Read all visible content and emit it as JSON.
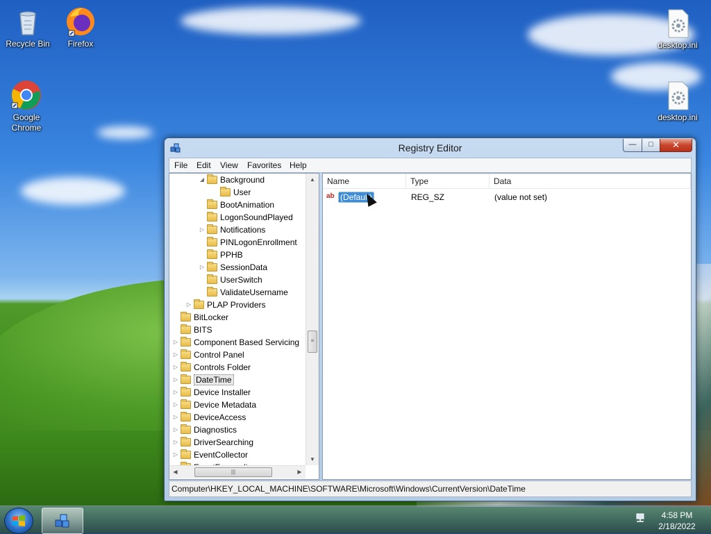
{
  "desktop": {
    "icons": [
      {
        "label": "Recycle Bin",
        "icon": "recycle-bin-icon"
      },
      {
        "label": "Firefox",
        "icon": "firefox-icon"
      },
      {
        "label": "Google Chrome",
        "icon": "chrome-icon"
      },
      {
        "label": "desktop.ini",
        "icon": "settings-file-icon"
      },
      {
        "label": "desktop.ini",
        "icon": "settings-file-icon"
      }
    ]
  },
  "window": {
    "title": "Registry Editor",
    "controls": {
      "minimize": "—",
      "maximize": "□",
      "close": "✕"
    },
    "menu": [
      "File",
      "Edit",
      "View",
      "Favorites",
      "Help"
    ]
  },
  "tree": {
    "items": [
      {
        "label": "Background",
        "expander": "◢",
        "level": 3
      },
      {
        "label": "User",
        "expander": "",
        "level": 4
      },
      {
        "label": "BootAnimation",
        "expander": "",
        "level": 3
      },
      {
        "label": "LogonSoundPlayed",
        "expander": "",
        "level": 3
      },
      {
        "label": "Notifications",
        "expander": "▷",
        "level": 3
      },
      {
        "label": "PINLogonEnrollment",
        "expander": "",
        "level": 3
      },
      {
        "label": "PPHB",
        "expander": "",
        "level": 3
      },
      {
        "label": "SessionData",
        "expander": "▷",
        "level": 3
      },
      {
        "label": "UserSwitch",
        "expander": "",
        "level": 3
      },
      {
        "label": "ValidateUsername",
        "expander": "",
        "level": 3
      },
      {
        "label": "PLAP Providers",
        "expander": "▷",
        "level": 2
      },
      {
        "label": "BitLocker",
        "expander": "",
        "level": 1
      },
      {
        "label": "BITS",
        "expander": "",
        "level": 1
      },
      {
        "label": "Component Based Servicing",
        "expander": "▷",
        "level": 1
      },
      {
        "label": "Control Panel",
        "expander": "▷",
        "level": 1
      },
      {
        "label": "Controls Folder",
        "expander": "▷",
        "level": 1
      },
      {
        "label": "DateTime",
        "expander": "▷",
        "level": 1,
        "selected": true
      },
      {
        "label": "Device Installer",
        "expander": "▷",
        "level": 1
      },
      {
        "label": "Device Metadata",
        "expander": "▷",
        "level": 1
      },
      {
        "label": "DeviceAccess",
        "expander": "▷",
        "level": 1
      },
      {
        "label": "Diagnostics",
        "expander": "▷",
        "level": 1
      },
      {
        "label": "DriverSearching",
        "expander": "▷",
        "level": 1
      },
      {
        "label": "EventCollector",
        "expander": "▷",
        "level": 1
      },
      {
        "label": "EventForwarding",
        "expander": "▷",
        "level": 1
      }
    ]
  },
  "values_list": {
    "columns": [
      "Name",
      "Type",
      "Data"
    ],
    "rows": [
      {
        "name": "(Default)",
        "type": "REG_SZ",
        "data": "(value not set)",
        "icon": "string-value-icon",
        "icon_text": "ab"
      }
    ]
  },
  "statusbar": {
    "path": "Computer\\HKEY_LOCAL_MACHINE\\SOFTWARE\\Microsoft\\Windows\\CurrentVersion\\DateTime"
  },
  "taskbar": {
    "clock_time": "4:58 PM",
    "clock_date": "2/18/2022"
  },
  "colors": {
    "selection": "#3e8bd8",
    "close_button": "#c8452c"
  }
}
